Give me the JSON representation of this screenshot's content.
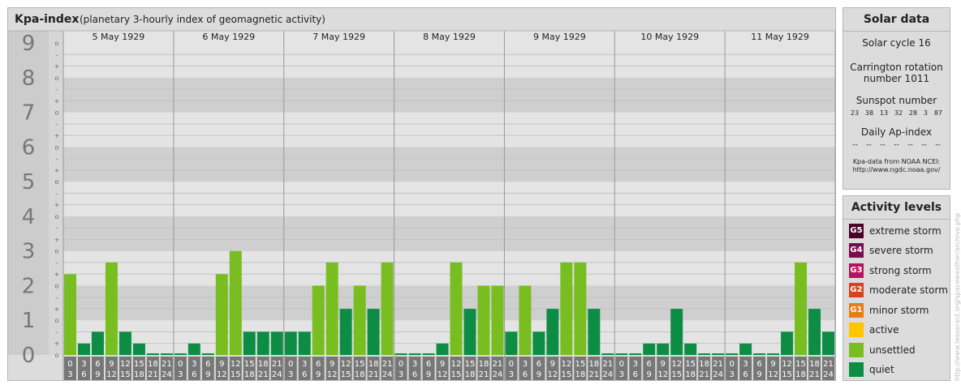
{
  "chart_data": {
    "type": "bar",
    "title": "Kpa-index",
    "subtitle": "(planetary 3-hourly index of geomagnetic activity)",
    "y_range": [
      0,
      9
    ],
    "y_ticks": [
      "0",
      "1",
      "2",
      "3",
      "4",
      "5",
      "6",
      "7",
      "8",
      "9"
    ],
    "minor_ticks": [
      "-",
      "o",
      "+"
    ],
    "days": [
      "5 May 1929",
      "6 May 1929",
      "7 May 1929",
      "8 May 1929",
      "9 May 1929",
      "10 May 1929",
      "11 May 1929"
    ],
    "interval_labels": [
      [
        "0",
        "3"
      ],
      [
        "3",
        "6"
      ],
      [
        "6",
        "9"
      ],
      [
        "9",
        "12"
      ],
      [
        "12",
        "15"
      ],
      [
        "15",
        "18"
      ],
      [
        "18",
        "21"
      ],
      [
        "21",
        "24"
      ]
    ],
    "values": [
      [
        2.33,
        0.33,
        0.67,
        2.67,
        0.67,
        0.33,
        0,
        0
      ],
      [
        0,
        0.33,
        0,
        2.33,
        3,
        0.67,
        0.67,
        0.67
      ],
      [
        0.67,
        0.67,
        2,
        2.67,
        1.33,
        2,
        1.33,
        2.67
      ],
      [
        0,
        0,
        0,
        0.33,
        2.67,
        1.33,
        2,
        2
      ],
      [
        0.67,
        2,
        0.67,
        1.33,
        2.67,
        2.67,
        1.33,
        0
      ],
      [
        0,
        0,
        0.33,
        0.33,
        1.33,
        0.33,
        0,
        0
      ],
      [
        0,
        0.33,
        0,
        0,
        0.67,
        2.67,
        1.33,
        0.67
      ]
    ],
    "colors": {
      "quiet": "#0d8c44",
      "unsettled": "#78be20",
      "active": "#fdc600"
    }
  },
  "solar": {
    "title": "Solar data",
    "cycle": "Solar cycle 16",
    "carrington_line1": "Carrington rotation",
    "carrington_line2": "number 1011",
    "sunspot_title": "Sunspot number",
    "sunspots": [
      "23",
      "38",
      "13",
      "32",
      "28",
      "3",
      "87"
    ],
    "ap_title": "Daily Ap-index",
    "ap_values": [
      "--",
      "--",
      "--",
      "--",
      "--",
      "--",
      "--"
    ],
    "credit_line1": "Kpa-data from NOAA NCEI:",
    "credit_line2": "http://www.ngdc.noaa.gov/"
  },
  "activity": {
    "title": "Activity levels",
    "levels": [
      {
        "code": "G5",
        "label": "extreme storm",
        "color": "#4b0028"
      },
      {
        "code": "G4",
        "label": "severe storm",
        "color": "#7a0c4c"
      },
      {
        "code": "G3",
        "label": "strong storm",
        "color": "#b5135f"
      },
      {
        "code": "G2",
        "label": "moderate storm",
        "color": "#d8401e"
      },
      {
        "code": "G1",
        "label": "minor storm",
        "color": "#e87c18"
      },
      {
        "code": "",
        "label": "active",
        "color": "#fdc600"
      },
      {
        "code": "",
        "label": "unsettled",
        "color": "#78be20"
      },
      {
        "code": "",
        "label": "quiet",
        "color": "#0d8c44"
      }
    ]
  },
  "watermark": "http://www.tesseract.org/spaceweather/archive.php"
}
